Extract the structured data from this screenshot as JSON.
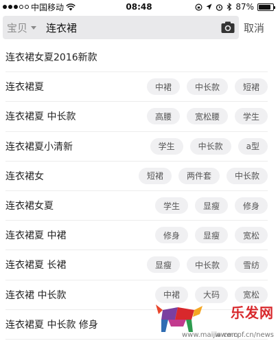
{
  "status_bar": {
    "carrier": "中国移动",
    "time": "08:48",
    "battery": "87%",
    "battery_level": 0.87
  },
  "search": {
    "scope": "宝贝",
    "query": "连衣裙",
    "cancel_label": "取消"
  },
  "suggestions": [
    {
      "text": "连衣裙女夏2016新款",
      "tags": []
    },
    {
      "text": "连衣裙夏",
      "tags": [
        "中裙",
        "中长款",
        "短裙"
      ]
    },
    {
      "text": "连衣裙夏 中长款",
      "tags": [
        "高腰",
        "宽松腰",
        "学生"
      ]
    },
    {
      "text": "连衣裙夏小清新",
      "tags": [
        "学生",
        "中长款",
        "a型"
      ]
    },
    {
      "text": "连衣裙女",
      "tags": [
        "短裙",
        "两件套",
        "中长款"
      ]
    },
    {
      "text": "连衣裙女夏",
      "tags": [
        "学生",
        "显瘦",
        "修身"
      ]
    },
    {
      "text": "连衣裙夏 中裙",
      "tags": [
        "修身",
        "显瘦",
        "宽松"
      ]
    },
    {
      "text": "连衣裙夏 长裙",
      "tags": [
        "显瘦",
        "中长款",
        "雪纺"
      ]
    },
    {
      "text": "连衣裙 中长款",
      "tags": [
        "中裙",
        "大码",
        "宽松"
      ]
    },
    {
      "text": "连衣裙夏 中长款 修身",
      "tags": []
    }
  ],
  "watermark": {
    "brand": "乐发网",
    "url_left": "www.maijia.com",
    "url_right": "www.cpf.cn/news"
  }
}
